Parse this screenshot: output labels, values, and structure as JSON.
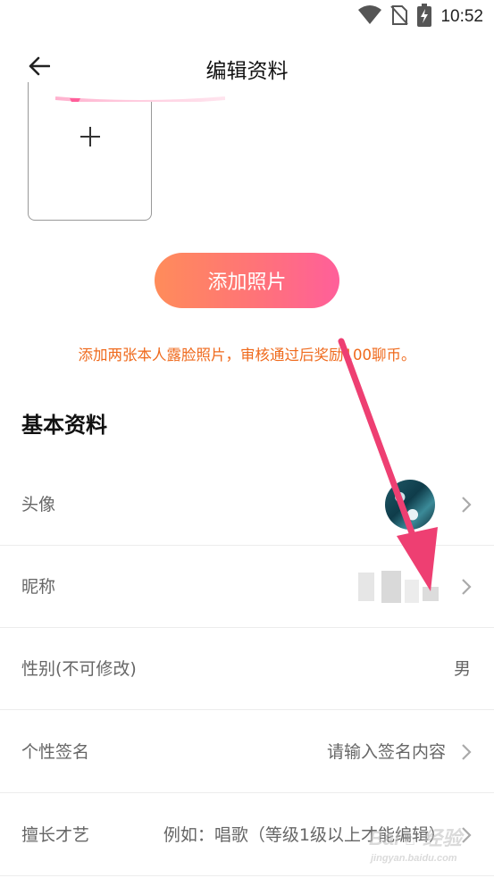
{
  "status_bar": {
    "time": "10:52",
    "icons": [
      "wifi-icon",
      "no-sim-icon",
      "battery-charging-icon"
    ]
  },
  "header": {
    "title": "编辑资料",
    "back_icon": "arrow-left-icon"
  },
  "photos": {
    "add_icon": "plus-icon",
    "add_button_label": "添加照片",
    "tip": "添加两张本人露脸照片，审核通过后奖励100聊币。"
  },
  "basic_info": {
    "section_title": "基本资料",
    "rows": [
      {
        "label": "头像",
        "value": "",
        "chevron": true
      },
      {
        "label": "昵称",
        "value": "",
        "chevron": true
      },
      {
        "label": "性别(不可修改)",
        "value": "男",
        "chevron": false
      },
      {
        "label": "个性签名",
        "value": "请输入签名内容",
        "chevron": true
      },
      {
        "label": "擅长才艺",
        "value": "例如：唱歌（等级1级以上才能编辑）",
        "chevron": true
      }
    ]
  },
  "colors": {
    "accent_gradient_start": "#ff8c5a",
    "accent_gradient_end": "#ff5f9a",
    "tip_color": "#ef6a1d",
    "annotation_arrow": "#ee3f72"
  }
}
